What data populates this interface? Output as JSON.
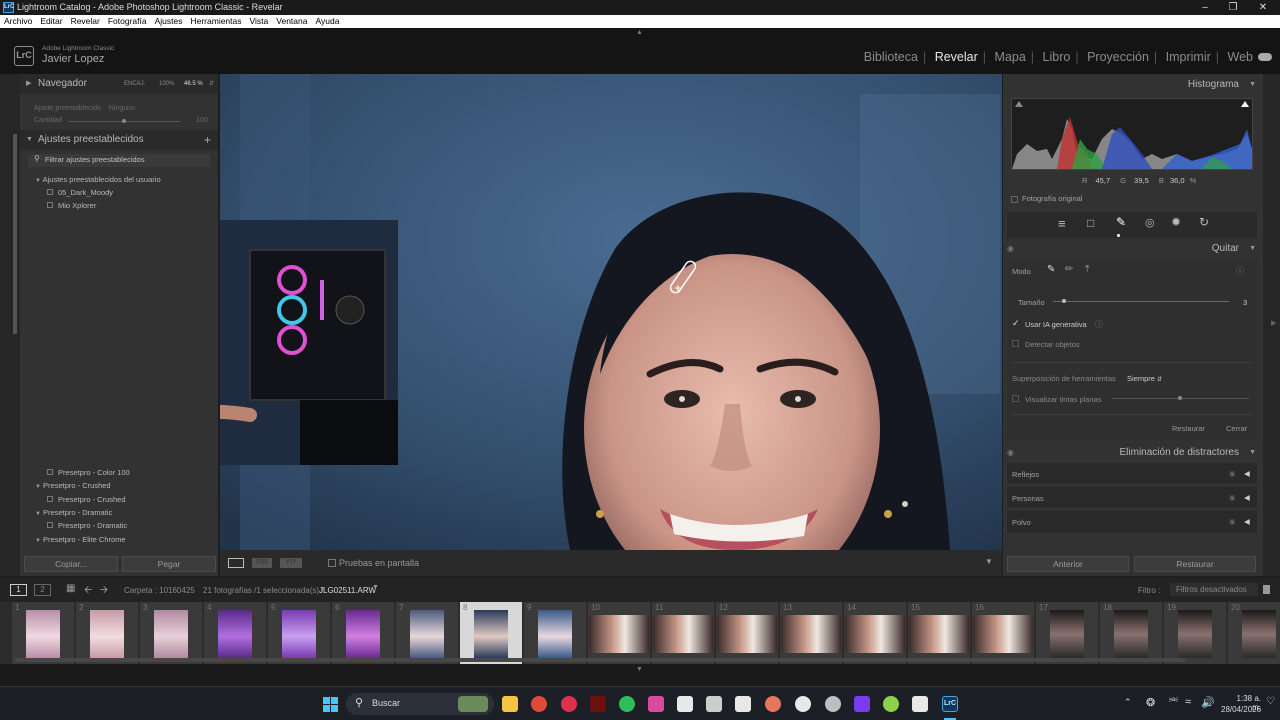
{
  "window": {
    "title": "Lightroom Catalog - Adobe Photoshop Lightroom Classic - Revelar",
    "logo": "LrC"
  },
  "menu": [
    "Archivo",
    "Editar",
    "Revelar",
    "Fotografía",
    "Ajustes",
    "Herramientas",
    "Vista",
    "Ventana",
    "Ayuda"
  ],
  "identity": {
    "product": "Adobe Lightroom Classic",
    "user": "Javier Lopez",
    "logo": "LrC"
  },
  "modules": [
    {
      "label": "Biblioteca",
      "active": false
    },
    {
      "label": "Revelar",
      "active": true
    },
    {
      "label": "Mapa",
      "active": false
    },
    {
      "label": "Libro",
      "active": false
    },
    {
      "label": "Proyección",
      "active": false
    },
    {
      "label": "Imprimir",
      "active": false
    },
    {
      "label": "Web",
      "active": false
    }
  ],
  "navigator": {
    "title": "Navegador",
    "fit": "ENCAJ.",
    "z1": "100%",
    "z2": "46.5 %"
  },
  "preset_amount": {
    "label": "Ajuste preestablecido",
    "value": "Ninguno",
    "amount_label": "Cantidad",
    "amount_value": "100"
  },
  "presets": {
    "title": "Ajustes preestablecidos",
    "filter": "Filtrar ajustes preestablecidos",
    "group_user": "Ajustes preestablecidos del usuario",
    "user_items": [
      "05_Dark_Moody",
      "Mio Xplorer"
    ],
    "lower": [
      {
        "text": "Presetpro - Color 100",
        "kind": "item"
      },
      {
        "text": "Presetpro - Crushed",
        "kind": "group"
      },
      {
        "text": "Presetpro - Crushed",
        "kind": "item"
      },
      {
        "text": "Presetpro - Dramatic",
        "kind": "group"
      },
      {
        "text": "Presetpro - Dramatic",
        "kind": "item"
      },
      {
        "text": "Presetpro - Elite Chrome",
        "kind": "group"
      }
    ]
  },
  "left_buttons": {
    "copy": "Copiar...",
    "paste": "Pegar"
  },
  "toolbar": {
    "proof": "Pruebas en pantalla"
  },
  "histogram": {
    "title": "Histograma",
    "r_label": "R",
    "r": "45,7",
    "g_label": "G",
    "g": "39,5",
    "b_label": "B",
    "b": "36,0",
    "unit": "%",
    "original": "Fotografía original"
  },
  "remove": {
    "title": "Quitar",
    "mode": "Modo",
    "size_label": "Tamaño",
    "size_value": "3",
    "size_level": 0.05,
    "gen_ai": "Usar IA generativa",
    "detect": "Detectar objetos",
    "overlay_label": "Superposición de herramientas",
    "overlay_value": "Siempre",
    "visualize": "Visualizar tintas planas",
    "reset": "Restaurar",
    "close": "Cerrar"
  },
  "distractions": {
    "title": "Eliminación de distractores",
    "items": [
      "Reflejos",
      "Personas",
      "Polvo"
    ]
  },
  "right_buttons": {
    "prev": "Anterior",
    "reset": "Restaurar"
  },
  "filmbar": {
    "folder": "Carpeta : 10160425",
    "count": "21 fotografías /1 seleccionada(s) /",
    "file": "JLG02511.ARW",
    "filter_label": "Filtro :",
    "filter_value": "Filtros desactivados",
    "p1": "1",
    "p2": "2"
  },
  "filmstrip": {
    "numbers": [
      "1",
      "2",
      "3",
      "4",
      "5",
      "6",
      "7",
      "8",
      "9",
      "10",
      "11",
      "12",
      "13",
      "14",
      "15",
      "16",
      "17",
      "18",
      "19",
      "20"
    ],
    "selected_index": 8
  },
  "taskbar": {
    "search": "Buscar",
    "time": "1:38 a. m.",
    "date": "28/04/2026"
  },
  "colors": {
    "accent": "#ffffff",
    "panel": "#323232",
    "bg": "#1e1e1e"
  }
}
